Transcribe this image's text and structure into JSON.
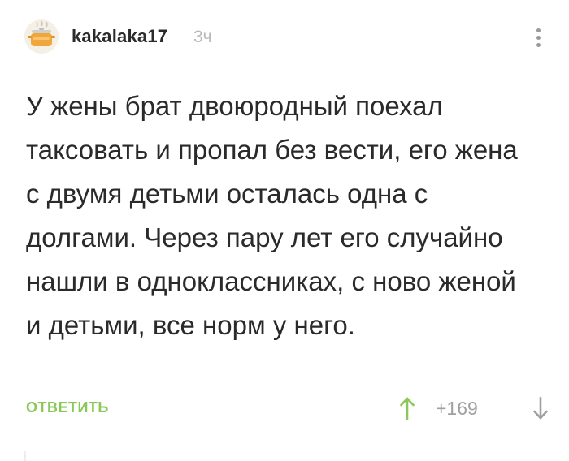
{
  "comment": {
    "author": "kakalaka17",
    "time_ago": "3ч",
    "text": "У жены брат двоюродный поехал таксовать и пропал без вести, его жена с двумя детьми осталась одна с долгами. Через пару лет его случайно нашли в одноклассниках, с ново женой и детьми, все норм у него.",
    "reply_label": "ОТВЕТИТЬ",
    "rating": "+169"
  },
  "icons": {
    "avatar": "cooking-pot-avatar",
    "more": "more-vertical-icon",
    "upvote": "arrow-up-icon",
    "downvote": "arrow-down-icon"
  },
  "colors": {
    "accent_green": "#8ac858",
    "muted_gray": "#a0a0a0",
    "text": "#2a2a2a"
  }
}
